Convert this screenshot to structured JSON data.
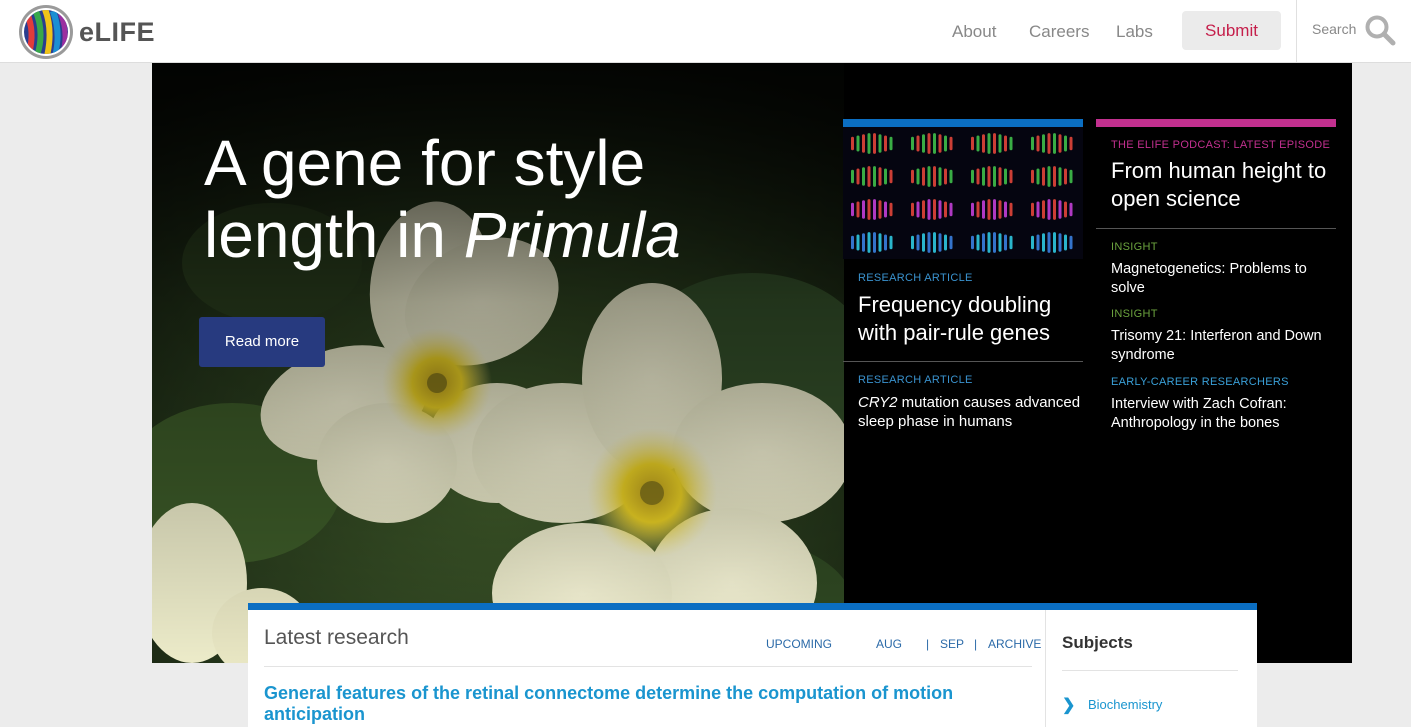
{
  "header": {
    "logo_text": "eLIFE",
    "nav": {
      "about": "About",
      "careers": "Careers",
      "labs": "Labs",
      "submit": "Submit"
    },
    "search_label": "Search"
  },
  "hero": {
    "title_main": "A gene for style length in ",
    "title_italic": "Primula",
    "read_more": "Read more"
  },
  "featured": {
    "col1": {
      "item1": {
        "category": "Research Article",
        "title": "Frequency doubling with pair-rule genes"
      },
      "item2": {
        "category": "Research Article",
        "title_italic": "CRY2",
        "title_rest": " mutation causes advanced sleep phase in humans"
      }
    },
    "col2": {
      "podcast": {
        "category": "The eLife Podcast: Latest episode",
        "title": "From human height to open science"
      },
      "items": [
        {
          "category": "Insight",
          "title": "Magnetogenetics: Problems to solve"
        },
        {
          "category": "Insight",
          "title": "Trisomy 21: Interferon and Down syndrome"
        },
        {
          "category": "Early-Career Researchers",
          "title": "Interview with Zach Cofran: Anthropology in the bones"
        }
      ]
    }
  },
  "latest": {
    "title": "Latest research",
    "nav": {
      "upcoming": "UPCOMING",
      "aug": "AUG",
      "sep": "SEP",
      "archive": "ARCHIVE",
      "separator": "|"
    },
    "article_title": "General features of the retinal connectome determine the computation of motion anticipation"
  },
  "subjects": {
    "title": "Subjects",
    "items": [
      "Biochemistry"
    ]
  },
  "colors": {
    "brand_blue": "#0b6ec2",
    "brand_pink": "#c2308f",
    "submit_red": "#c51f4b",
    "button_navy": "#273a7f",
    "link_blue": "#1a95cf"
  }
}
